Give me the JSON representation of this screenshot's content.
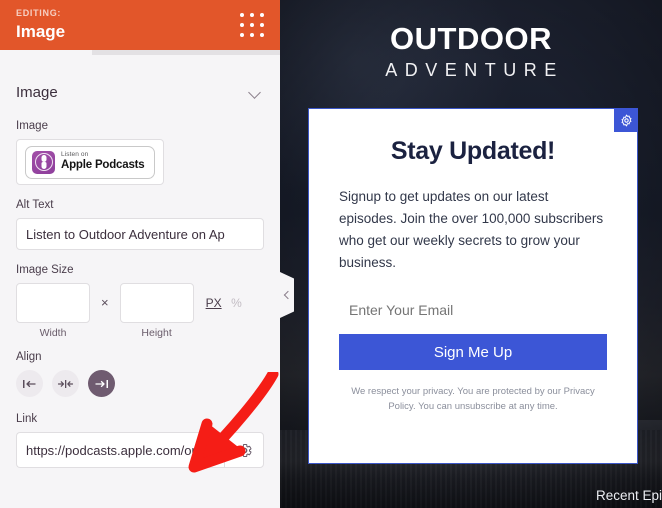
{
  "sidebar": {
    "header": {
      "editing_label": "EDITING:",
      "editing_title": "Image",
      "drag_handle_icon": "grid-dots-icon"
    },
    "accordion": {
      "title": "Image",
      "chevron_icon": "chevron-down-icon"
    },
    "image_field": {
      "label": "Image",
      "badge_listen_on": "Listen on",
      "badge_name": "Apple Podcasts",
      "badge_icon": "apple-podcasts-icon"
    },
    "alt_text_field": {
      "label": "Alt Text",
      "value": "Listen to Outdoor Adventure on Ap",
      "placeholder": "Alt Text"
    },
    "image_size_field": {
      "label": "Image Size",
      "width_value": "",
      "width_caption": "Width",
      "height_value": "",
      "height_caption": "Height",
      "separator": "×",
      "unit_px": "PX",
      "unit_percent": "%",
      "unit_active": "PX"
    },
    "align_field": {
      "label": "Align",
      "options": [
        {
          "name": "align-left",
          "icon": "align-left-icon",
          "active": false
        },
        {
          "name": "align-center",
          "icon": "align-center-icon",
          "active": false
        },
        {
          "name": "align-right",
          "icon": "align-right-icon",
          "active": true
        }
      ]
    },
    "link_field": {
      "label": "Link",
      "value": "https://podcasts.apple.com/ou",
      "placeholder": "https://",
      "settings_icon": "gear-icon"
    },
    "colors": {
      "header_orange": "#e2562a",
      "panel_bg": "#f6f5f7",
      "active_purple": "#6f5b70"
    }
  },
  "annotation": {
    "arrow_icon": "red-arrow-icon",
    "arrow_color": "#f51d16"
  },
  "preview": {
    "collapse_handle_icon": "chevron-left-icon",
    "brand": {
      "line1": "OUTDOOR",
      "line2": "ADVENTURE"
    },
    "optin": {
      "title": "Stay Updated!",
      "body": "Signup to get updates on our latest episodes. Join the over 100,000 subscribers who get our weekly secrets to grow your business.",
      "email_placeholder": "Enter Your Email",
      "submit_label": "Sign Me Up",
      "fine_print": "We respect your privacy. You are protected by our Privacy Policy. You can unsubscribe at any time.",
      "settings_icon": "gear-icon",
      "accent_color": "#3c56d6"
    },
    "recent_episodes_heading": "Recent Episodes"
  }
}
